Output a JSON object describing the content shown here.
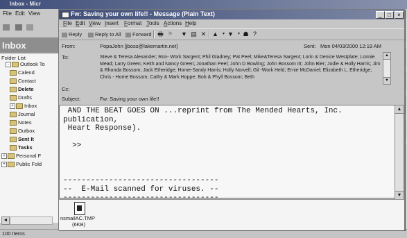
{
  "background_window": {
    "title": "Inbox - Micr",
    "menu": [
      "File",
      "Edit",
      "View"
    ],
    "inbox_header": "Inbox",
    "folder_list_label": "Folder List",
    "folders": [
      {
        "label": "Outlook To",
        "bold": false,
        "indent": 1,
        "expand": "-"
      },
      {
        "label": "Calend",
        "bold": false,
        "indent": 2
      },
      {
        "label": "Contact",
        "bold": false,
        "indent": 2
      },
      {
        "label": "Delete",
        "bold": true,
        "indent": 2
      },
      {
        "label": "Drafts",
        "bold": false,
        "indent": 2
      },
      {
        "label": "Inbox",
        "bold": false,
        "indent": 2,
        "expand": "+"
      },
      {
        "label": "Journal",
        "bold": false,
        "indent": 2
      },
      {
        "label": "Notes",
        "bold": false,
        "indent": 2
      },
      {
        "label": "Outbox",
        "bold": false,
        "indent": 2
      },
      {
        "label": "Sent It",
        "bold": true,
        "indent": 2
      },
      {
        "label": "Tasks",
        "bold": true,
        "indent": 2
      },
      {
        "label": "Personal F",
        "bold": false,
        "indent": 0,
        "expand": "+"
      },
      {
        "label": "Public Fold",
        "bold": false,
        "indent": 0,
        "expand": "+"
      }
    ],
    "status": "100 Items"
  },
  "message": {
    "title": "Fw: Saving your own life!! - Message (Plain Text)",
    "window_buttons": [
      "_",
      "□",
      "×"
    ],
    "menu": [
      "File",
      "Edit",
      "View",
      "Insert",
      "Format",
      "Tools",
      "Actions",
      "Help"
    ],
    "toolbar": {
      "reply": "Reply",
      "reply_all": "Reply to All",
      "forward": "Forward"
    },
    "from_label": "From:",
    "from_value": "PopaJohn [jboss@lakemartin.net]",
    "sent_label": "Sent:",
    "sent_value": "Mon 04/03/2000 12:19 AM",
    "to_label": "To:",
    "to_value": "Steve & Teresa Alexander; Ron- Work Sargent; Phil Gladney; Pat Peel; Mike&Teresa Sargent; Lorin & Denice Westplate; Lonnie Mead; Larry Green; Keith and Nancy Green; Jonathan Peel; John D Bowling; John Bossom III; John Bier; Jodie & Holly Harris; Jim & Rhonda Bossom; Jack Etheridge; Home-Sandy Harris; Holly Norvell; Gil -Work Held; Ernie McDaniel; Elizabeth L. Etheridge; Chris - Home Bossom; Cathy & Mark Hoppe; Bob & Phyll Bossom; Beth",
    "cc_label": "Cc:",
    "subject_label": "Subject:",
    "subject_value": "Fw: Saving your own life!!",
    "body": " AND THE BEAT GOES ON ...reprint from The Mended Hearts, Inc.\npublication,\n Heart Response).\n\n  >>\n\n\n\n----------------------------------\n--  E-Mail scanned for viruses. --\n----------------------------------",
    "attachment_name": "nsmailAC.TMP",
    "attachment_size": "(6KB)"
  }
}
